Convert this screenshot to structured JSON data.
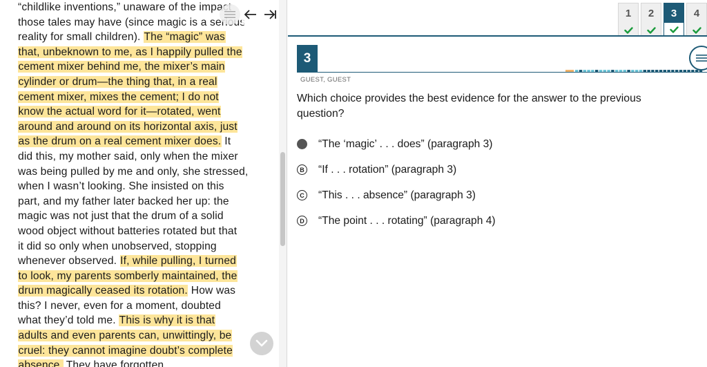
{
  "passage": {
    "lines": [
      [
        {
          "t": "“childlike inventions,” unaware of the impact",
          "h": false
        }
      ],
      [
        {
          "t": "those tales may have (since magic is a serious",
          "h": false
        }
      ],
      [
        {
          "t": "reality for small children). ",
          "h": false
        },
        {
          "t": "The “magic” was",
          "h": true
        }
      ],
      [
        {
          "t": "that, unbeknown to me, as I happily pulled the",
          "h": true
        }
      ],
      [
        {
          "t": "cement mixer behind me, the mixer’s main",
          "h": true
        }
      ],
      [
        {
          "t": "cylinder or drum—the thing that, in a real",
          "h": true
        }
      ],
      [
        {
          "t": "cement mixer, mixes the cement; I do not",
          "h": true
        }
      ],
      [
        {
          "t": "know the actual word for it—rotated, went",
          "h": true
        }
      ],
      [
        {
          "t": "around and around on its horizontal axis, just",
          "h": true
        }
      ],
      [
        {
          "t": "as the drum on a real cement mixer does.",
          "h": true
        },
        {
          "t": " It",
          "h": false
        }
      ],
      [
        {
          "t": "did this, my mother said, only when the mixer",
          "h": false
        }
      ],
      [
        {
          "t": "was being pulled by me and only, she stressed,",
          "h": false
        }
      ],
      [
        {
          "t": "when I wasn’t looking. She insisted on this",
          "h": false
        }
      ],
      [
        {
          "t": "part, and my father later backed her up: the",
          "h": false
        }
      ],
      [
        {
          "t": "magic was not just that the drum of a solid",
          "h": false
        }
      ],
      [
        {
          "t": "wood object without batteries rotated but that",
          "h": false
        }
      ],
      [
        {
          "t": "it did so only when unobserved, stopping",
          "h": false
        }
      ],
      [
        {
          "t": "whenever observed. ",
          "h": false
        },
        {
          "t": "If, while pulling, I turned",
          "h": true
        }
      ],
      [
        {
          "t": "to look, my parents somberly maintained, the",
          "h": true
        }
      ],
      [
        {
          "t": "drum magically ceased its rotation.",
          "h": true
        },
        {
          "t": " How was",
          "h": false
        }
      ],
      [
        {
          "t": "this? I never, even for a moment, doubted",
          "h": false
        }
      ],
      [
        {
          "t": "what they’d told me. ",
          "h": false
        },
        {
          "t": "This is why it is that",
          "h": true
        }
      ],
      [
        {
          "t": "adults and even parents can, unwittingly, be",
          "h": true
        }
      ],
      [
        {
          "t": "cruel: they cannot imagine doubt’s complete",
          "h": true
        }
      ],
      [
        {
          "t": "absence.",
          "h": true
        },
        {
          "t": " They have forgotten.",
          "h": false
        }
      ]
    ]
  },
  "passage_tools": {
    "lines_icon": "text-lines-icon",
    "back_icon": "arrow-left-icon",
    "forward_icon": "arrow-right-icon",
    "scroll_icon": "chevron-down-icon"
  },
  "question_tabs": [
    {
      "number": "1",
      "status": "answered",
      "active": false
    },
    {
      "number": "2",
      "status": "answered",
      "active": false
    },
    {
      "number": "3",
      "status": "answered",
      "active": true
    },
    {
      "number": "4",
      "status": "answered",
      "active": false
    }
  ],
  "question": {
    "number": "3",
    "user_label": "GUEST, GUEST",
    "text": "Which choice provides the best evidence for the answer to the previous question?",
    "options": [
      {
        "letter": "A",
        "text": "“The ‘magic’ . . . does” (paragraph 3)",
        "selected": true
      },
      {
        "letter": "B",
        "text": "“If . . . rotation” (paragraph 3)",
        "selected": false
      },
      {
        "letter": "C",
        "text": "“This . . . absence” (paragraph 3)",
        "selected": false
      },
      {
        "letter": "D",
        "text": "“The point . . . rotating” (paragraph 4)",
        "selected": false
      }
    ]
  },
  "colors": {
    "accent": "#1d5a76",
    "highlight": "#fde59a",
    "check": "#1a9b3c",
    "progress_light": "#6cc4d6",
    "progress_dark": "#1d5a76",
    "progress_warn": "#f0b36a"
  }
}
